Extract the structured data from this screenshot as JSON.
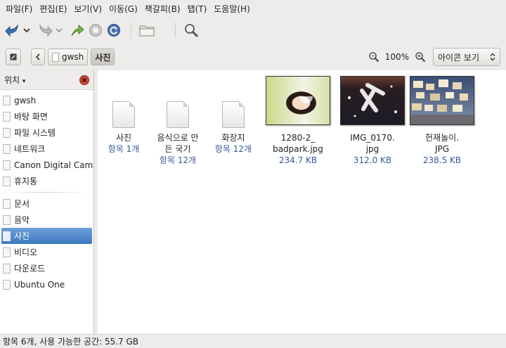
{
  "menubar": {
    "items": [
      "파일(F)",
      "편집(E)",
      "보기(V)",
      "이동(G)",
      "책갈피(B)",
      "탭(T)",
      "도움말(H)"
    ]
  },
  "toolbar": {
    "buttons": [
      "back-icon",
      "forward-icon",
      "up-icon",
      "stop-icon",
      "reload-icon",
      "home-folder-icon",
      "search-icon"
    ]
  },
  "location": {
    "path": [
      "gwsh",
      "사진"
    ],
    "zoom": "100%",
    "view_mode": "아이콘 보기"
  },
  "sidebar": {
    "header": "위치",
    "items": [
      {
        "label": "gwsh"
      },
      {
        "label": "바탕 화면"
      },
      {
        "label": "파일 시스템"
      },
      {
        "label": "네트워크"
      },
      {
        "label": "Canon Digital Cam…"
      },
      {
        "label": "휴지통"
      },
      {
        "label": "문서"
      },
      {
        "label": "음악"
      },
      {
        "label": "사진"
      },
      {
        "label": "비디오"
      },
      {
        "label": "다운로드"
      },
      {
        "label": "Ubuntu One"
      }
    ],
    "selected": "사진"
  },
  "files": [
    {
      "name": "사진",
      "line2": "",
      "info": "항목 1개",
      "kind": "folder"
    },
    {
      "name": "음식으로 만",
      "line2": "든 국기",
      "info": "항목 12개",
      "kind": "folder"
    },
    {
      "name": "화장지",
      "line2": "",
      "info": "항목 12개",
      "kind": "folder"
    },
    {
      "name": "1280-2_",
      "line2": "badpark.jpg",
      "info": "234.7 KB",
      "kind": "image"
    },
    {
      "name": "IMG_0170.",
      "line2": "jpg",
      "info": "312.0 KB",
      "kind": "image"
    },
    {
      "name": "헌재놀이.",
      "line2": "JPG",
      "info": "238.5 KB",
      "kind": "image"
    }
  ],
  "status": "항목 6개, 사용 가능한 공간: 55.7 GB"
}
